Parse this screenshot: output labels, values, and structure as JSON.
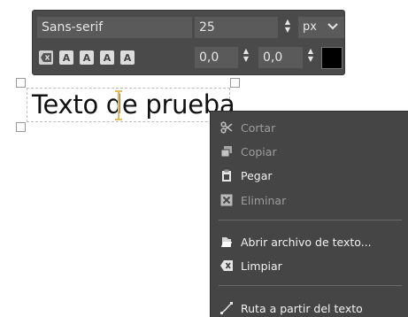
{
  "toolbar": {
    "font_value": "Sans-serif",
    "size_value": "25",
    "unit_value": "px",
    "x_value": "0,0",
    "y_value": "0,0",
    "color_value": "#000000",
    "style_buttons": [
      "A",
      "A",
      "A",
      "A"
    ]
  },
  "canvas": {
    "text": "Texto de prueba"
  },
  "context_menu": {
    "items": [
      {
        "label": "Cortar",
        "icon": "scissors-icon",
        "enabled": false
      },
      {
        "label": "Copiar",
        "icon": "copy-icon",
        "enabled": false
      },
      {
        "label": "Pegar",
        "icon": "paste-icon",
        "enabled": true
      },
      {
        "label": "Eliminar",
        "icon": "delete-icon",
        "enabled": false
      },
      {
        "label": "Abrir archivo de texto...",
        "icon": "open-file-icon",
        "enabled": true
      },
      {
        "label": "Limpiar",
        "icon": "clear-icon",
        "enabled": true
      },
      {
        "label": "Ruta a partir del texto",
        "icon": "path-icon",
        "enabled": true
      }
    ]
  }
}
